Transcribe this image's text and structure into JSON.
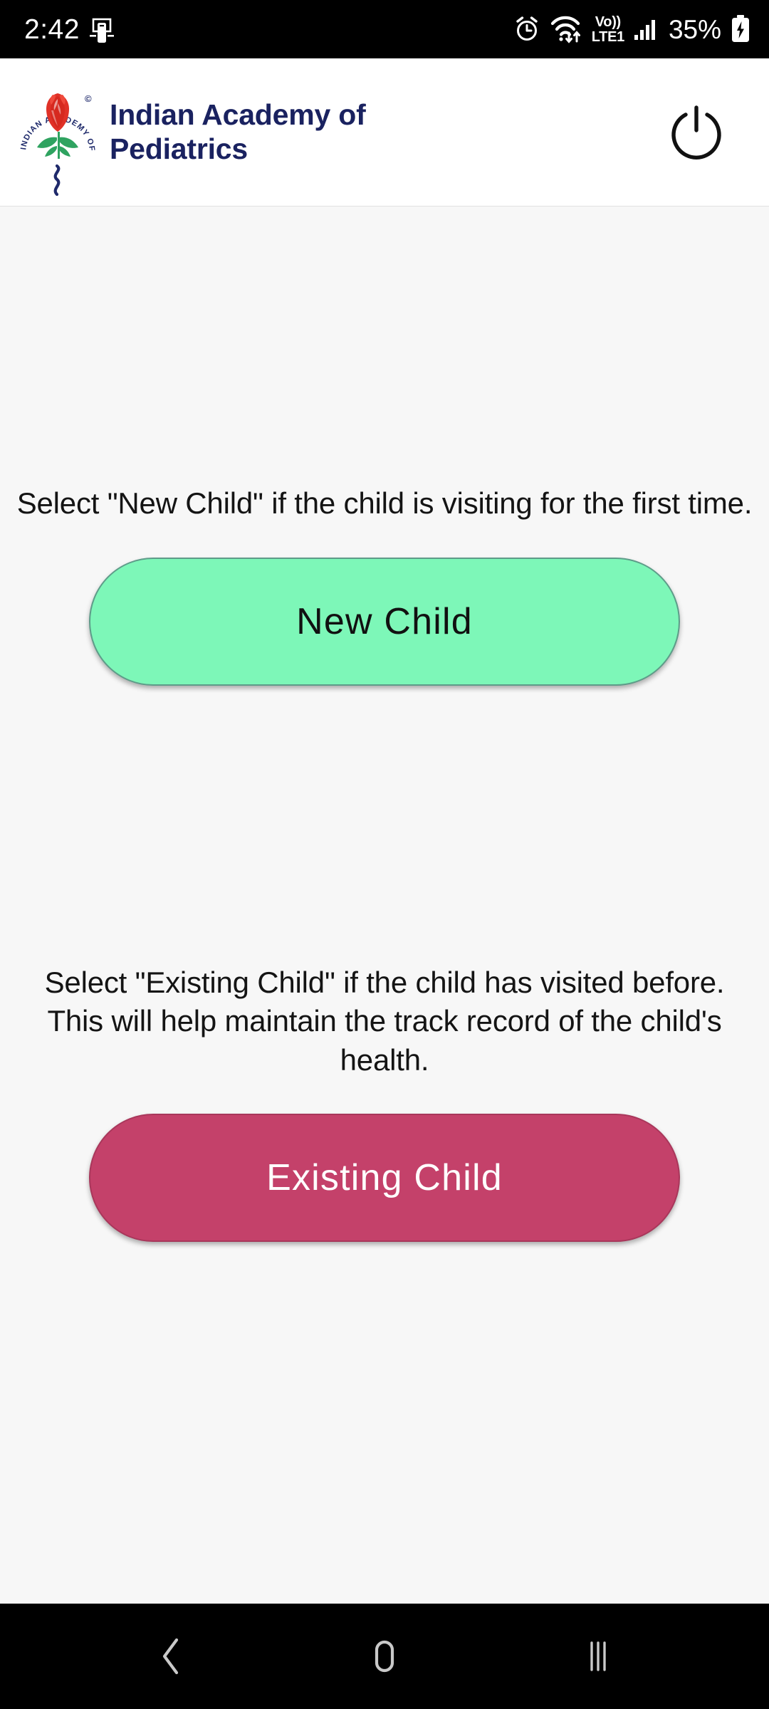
{
  "status_bar": {
    "time": "2:42",
    "screen_record_icon": "phone-cast-icon",
    "alarm_icon": "alarm-clock-icon",
    "wifi_icon": "wifi-data-transfer-icon",
    "volte_top": "Vo))",
    "volte_bottom": "LTE1",
    "signal_icon": "signal-bars-icon",
    "battery_percent": "35%",
    "battery_icon": "battery-charging-icon",
    "background_color": "#000000",
    "text_color": "#FFFFFF"
  },
  "header": {
    "logo_name": "indian-academy-of-pediatrics-logo",
    "logo_ring_text": "INDIAN ACADEMY OF PEDIATRICS",
    "logo_copyright": "©",
    "title": "Indian Academy of\nPediatrics",
    "title_color": "#1A2260",
    "background_color": "#FFFFFF",
    "power_button_label": "power-off"
  },
  "main": {
    "background_color": "#F7F7F7",
    "new_child": {
      "instruction": "Select \"New Child\" if the child is visiting for the first time.",
      "button_label": "New Child",
      "button_color": "#7DF7B8",
      "button_text_color": "#111111"
    },
    "existing_child": {
      "instruction": "Select \"Existing Child\" if the child has visited before. This will help maintain the track record of the child's health.",
      "button_label": "Existing Child",
      "button_color": "#C4416A",
      "button_text_color": "#FFFFFF"
    }
  },
  "nav_bar": {
    "back_label": "back-navigation",
    "home_label": "home-navigation",
    "recents_label": "recent-apps",
    "background_color": "#000000"
  }
}
